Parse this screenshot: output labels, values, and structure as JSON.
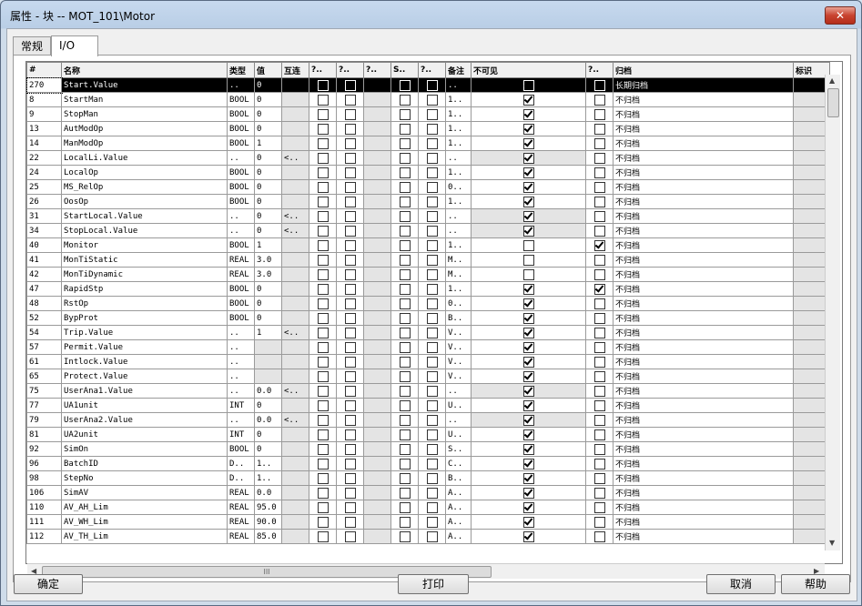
{
  "window": {
    "title": "属性 - 块 -- MOT_101\\Motor",
    "close_glyph": "✕"
  },
  "tabs": [
    {
      "label": "常规"
    },
    {
      "label": "I/O"
    }
  ],
  "columns": [
    "#",
    "名称",
    "类型",
    "值",
    "互连",
    "?..",
    "?..",
    "?..",
    "S..",
    "?..",
    "备注",
    "不可见",
    "?..",
    "归档",
    "标识"
  ],
  "rows": [
    {
      "num": "270",
      "name": "Start.Value",
      "type": "..",
      "val": "0",
      "ic": "",
      "rem": "..",
      "c1": true,
      "c2": false,
      "c3": false,
      "c4": false,
      "inv": true,
      "q": false,
      "arch": "长期归档",
      "sel": true
    },
    {
      "num": "8",
      "name": "StartMan",
      "type": "BOOL",
      "val": "0",
      "ic": "",
      "rem": "1..",
      "inv": true,
      "q": false,
      "arch": "不归档"
    },
    {
      "num": "9",
      "name": "StopMan",
      "type": "BOOL",
      "val": "0",
      "ic": "",
      "rem": "1..",
      "inv": true,
      "q": false,
      "arch": "不归档"
    },
    {
      "num": "13",
      "name": "AutModOp",
      "type": "BOOL",
      "val": "0",
      "ic": "",
      "rem": "1..",
      "inv": true,
      "q": false,
      "arch": "不归档"
    },
    {
      "num": "14",
      "name": "ManModOp",
      "type": "BOOL",
      "val": "1",
      "ic": "",
      "rem": "1..",
      "inv": true,
      "q": false,
      "arch": "不归档"
    },
    {
      "num": "22",
      "name": "LocalLi.Value",
      "type": "..",
      "val": "0",
      "ic": "<..",
      "rem": "..",
      "inv": true,
      "q": false,
      "arch": "不归档"
    },
    {
      "num": "24",
      "name": "LocalOp",
      "type": "BOOL",
      "val": "0",
      "ic": "",
      "rem": "1..",
      "inv": true,
      "q": false,
      "arch": "不归档"
    },
    {
      "num": "25",
      "name": "MS_RelOp",
      "type": "BOOL",
      "val": "0",
      "ic": "",
      "rem": "0..",
      "inv": true,
      "q": false,
      "arch": "不归档"
    },
    {
      "num": "26",
      "name": "OosOp",
      "type": "BOOL",
      "val": "0",
      "ic": "",
      "rem": "1..",
      "inv": true,
      "q": false,
      "arch": "不归档"
    },
    {
      "num": "31",
      "name": "StartLocal.Value",
      "type": "..",
      "val": "0",
      "ic": "<..",
      "rem": "..",
      "inv": true,
      "q": false,
      "arch": "不归档"
    },
    {
      "num": "34",
      "name": "StopLocal.Value",
      "type": "..",
      "val": "0",
      "ic": "<..",
      "rem": "..",
      "inv": true,
      "q": false,
      "arch": "不归档"
    },
    {
      "num": "40",
      "name": "Monitor",
      "type": "BOOL",
      "val": "1",
      "ic": "",
      "rem": "1..",
      "inv": false,
      "q": true,
      "arch": "不归档"
    },
    {
      "num": "41",
      "name": "MonTiStatic",
      "type": "REAL",
      "val": "3.0",
      "ic": "",
      "rem": "M..",
      "inv": false,
      "q": false,
      "arch": "不归档"
    },
    {
      "num": "42",
      "name": "MonTiDynamic",
      "type": "REAL",
      "val": "3.0",
      "ic": "",
      "rem": "M..",
      "inv": false,
      "q": false,
      "arch": "不归档"
    },
    {
      "num": "47",
      "name": "RapidStp",
      "type": "BOOL",
      "val": "0",
      "ic": "",
      "rem": "1..",
      "inv": true,
      "q": true,
      "arch": "不归档"
    },
    {
      "num": "48",
      "name": "RstOp",
      "type": "BOOL",
      "val": "0",
      "ic": "",
      "rem": "0..",
      "inv": true,
      "q": false,
      "arch": "不归档"
    },
    {
      "num": "52",
      "name": "BypProt",
      "type": "BOOL",
      "val": "0",
      "ic": "",
      "rem": "B..",
      "inv": true,
      "q": false,
      "arch": "不归档"
    },
    {
      "num": "54",
      "name": "Trip.Value",
      "type": "..",
      "val": "1",
      "ic": "<..",
      "rem": "V..",
      "inv": true,
      "q": false,
      "arch": "不归档"
    },
    {
      "num": "57",
      "name": "Permit.Value",
      "type": "..",
      "val": "",
      "ic": "",
      "rem": "V..",
      "inv": true,
      "q": false,
      "arch": "不归档"
    },
    {
      "num": "61",
      "name": "Intlock.Value",
      "type": "..",
      "val": "",
      "ic": "",
      "rem": "V..",
      "inv": true,
      "q": false,
      "arch": "不归档"
    },
    {
      "num": "65",
      "name": "Protect.Value",
      "type": "..",
      "val": "",
      "ic": "",
      "rem": "V..",
      "inv": true,
      "q": false,
      "arch": "不归档"
    },
    {
      "num": "75",
      "name": "UserAna1.Value",
      "type": "..",
      "val": "0.0",
      "ic": "<..",
      "rem": "..",
      "inv": true,
      "q": false,
      "arch": "不归档"
    },
    {
      "num": "77",
      "name": "UA1unit",
      "type": "INT",
      "val": "0",
      "ic": "",
      "rem": "U..",
      "inv": true,
      "q": false,
      "arch": "不归档"
    },
    {
      "num": "79",
      "name": "UserAna2.Value",
      "type": "..",
      "val": "0.0",
      "ic": "<..",
      "rem": "..",
      "inv": true,
      "q": false,
      "arch": "不归档"
    },
    {
      "num": "81",
      "name": "UA2unit",
      "type": "INT",
      "val": "0",
      "ic": "",
      "rem": "U..",
      "inv": true,
      "q": false,
      "arch": "不归档"
    },
    {
      "num": "92",
      "name": "SimOn",
      "type": "BOOL",
      "val": "0",
      "ic": "",
      "rem": "S..",
      "inv": true,
      "q": false,
      "arch": "不归档"
    },
    {
      "num": "96",
      "name": "BatchID",
      "type": "D..",
      "val": "1..",
      "ic": "",
      "rem": "C..",
      "inv": true,
      "q": false,
      "arch": "不归档"
    },
    {
      "num": "98",
      "name": "StepNo",
      "type": "D..",
      "val": "1..",
      "ic": "",
      "rem": "B..",
      "inv": true,
      "q": false,
      "arch": "不归档"
    },
    {
      "num": "106",
      "name": "SimAV",
      "type": "REAL",
      "val": "0.0",
      "ic": "",
      "rem": "A..",
      "inv": true,
      "q": false,
      "arch": "不归档"
    },
    {
      "num": "110",
      "name": "AV_AH_Lim",
      "type": "REAL",
      "val": "95.0",
      "ic": "",
      "rem": "A..",
      "inv": true,
      "q": false,
      "arch": "不归档"
    },
    {
      "num": "111",
      "name": "AV_WH_Lim",
      "type": "REAL",
      "val": "90.0",
      "ic": "",
      "rem": "A..",
      "inv": true,
      "q": false,
      "arch": "不归档"
    },
    {
      "num": "112",
      "name": "AV_TH_Lim",
      "type": "REAL",
      "val": "85.0",
      "ic": "",
      "rem": "A..",
      "inv": true,
      "q": false,
      "arch": "不归档"
    }
  ],
  "hscroll_thumb": "III",
  "buttons": {
    "ok": "确定",
    "print": "打印",
    "cancel": "取消",
    "help": "帮助"
  }
}
